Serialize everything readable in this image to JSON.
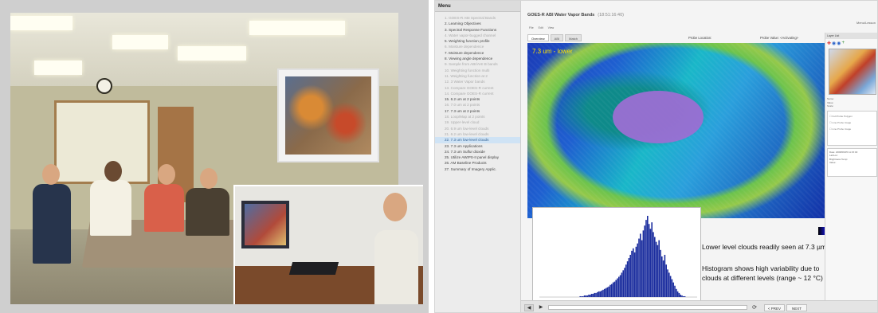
{
  "photo": {
    "alt_subject": "training room with participants and instructor workstation"
  },
  "app": {
    "menu_title": "Menu",
    "menu_items": [
      {
        "label": "1. GOES-R ABI Spectral Bands",
        "state": "dim"
      },
      {
        "label": "2. Learning Objectives",
        "state": "visited"
      },
      {
        "label": "3. Spectral Response Functions",
        "state": "visited"
      },
      {
        "label": "4. Water vapor-bugged channel",
        "state": "dim"
      },
      {
        "label": "5. Weighting function profile",
        "state": "visited"
      },
      {
        "label": "6. Moisture dependence",
        "state": "dim"
      },
      {
        "label": "7. Moisture dependence",
        "state": "visited"
      },
      {
        "label": "8. Viewing angle dependence",
        "state": "visited"
      },
      {
        "label": "9. Sample from ABI/AHI B bands",
        "state": "dim"
      },
      {
        "label": "10. Weighting function multi",
        "state": "dim"
      },
      {
        "label": "11. Weighting function at 2",
        "state": "dim"
      },
      {
        "label": "12. 3 Water Vapor bands",
        "state": "dim"
      },
      {
        "label": "13. Compare GOES-R current",
        "state": "dim"
      },
      {
        "label": "14. Compare GOES-R current",
        "state": "dim"
      },
      {
        "label": "15. 6.2 um at 2 points",
        "state": "visited"
      },
      {
        "label": "16. 7.0 um at 2 points",
        "state": "dim"
      },
      {
        "label": "17. 7.3 um at 2 points",
        "state": "visited"
      },
      {
        "label": "18. Loop/Map at 2 points",
        "state": "dim"
      },
      {
        "label": "19. Upper-level cloud",
        "state": "dim"
      },
      {
        "label": "20. 6.9 um low-level clouds",
        "state": "dim"
      },
      {
        "label": "21. 6.2 um low-level clouds",
        "state": "dim"
      },
      {
        "label": "22. 7.3 um low-level clouds",
        "state": "active"
      },
      {
        "label": "23. 7.3 um Applications",
        "state": "visited"
      },
      {
        "label": "24. 7.3 um Sulfur dioxide",
        "state": "visited"
      },
      {
        "label": "25. Utilize AWIPS-II panel display",
        "state": "visited"
      },
      {
        "label": "26. AM Baseline Products",
        "state": "visited"
      },
      {
        "label": "27. Summary of Imagery Applic.",
        "state": "visited"
      }
    ],
    "title": "GOES-R ABI Water Vapor Bands",
    "title_time": "(18:51:16:40)",
    "topright": "Menu/Lesson",
    "mini_tabs": [
      "File",
      "Edit",
      "View"
    ],
    "tabs": [
      {
        "label": "Overview",
        "active": true
      },
      {
        "label": "ABI",
        "active": false
      },
      {
        "label": "Match",
        "active": false
      }
    ],
    "probe_location_label": "Probe Location:",
    "probe_value_label": "Probe Value: <Activating>",
    "band_label": "7.3 um - lower",
    "annotation_1": "Lower level clouds readily seen at 7.3 µm.",
    "annotation_2": "Histogram shows high variability due to clouds at different levels (range ~ 12 °C)",
    "color_table": "Color table: 11 Alt random",
    "prev_label": "< PREV",
    "next_label": "NEXT",
    "refresh_glyph": "⟳",
    "play_glyph": "◀",
    "frame_glyph": "▶",
    "right_panel": {
      "header": "Layer List",
      "tools": [
        "✚",
        "◉",
        "◉",
        "+"
      ],
      "fields": [
        "Name:",
        "Value:",
        "Scale:"
      ],
      "checkbox_items": [
        "Full Probe Polygon",
        "Line Probe Image",
        "Line Probe Image"
      ],
      "info_lines": [
        "Date: 2008/06/05 11:15:00",
        "Lat/Lon:",
        "Brightness Temp:",
        "Value:"
      ]
    },
    "colors": {
      "active_menu_bg": "#cfe3f5",
      "band_label": "#ffe500",
      "probe_region": "#9b6fd3",
      "histogram_bars": "#1b2d9e"
    }
  },
  "chart_data": {
    "type": "bar",
    "title": "",
    "xlabel": "",
    "ylabel": "",
    "description_bins": "brightness temperature histogram of probe region, unimodal, right-skewed",
    "values": [
      0,
      0,
      0,
      0,
      0,
      0,
      0,
      0,
      0,
      0,
      0,
      0,
      0,
      0,
      0,
      0,
      0,
      0,
      0,
      0,
      0,
      0,
      0,
      0,
      0,
      0,
      0,
      0,
      1,
      1,
      1,
      2,
      2,
      2,
      3,
      3,
      4,
      4,
      5,
      5,
      6,
      7,
      7,
      8,
      9,
      10,
      11,
      12,
      13,
      15,
      16,
      18,
      19,
      21,
      23,
      25,
      27,
      30,
      33,
      36,
      40,
      44,
      48,
      52,
      57,
      60,
      55,
      62,
      66,
      72,
      78,
      70,
      82,
      88,
      95,
      100,
      90,
      84,
      92,
      80,
      74,
      68,
      64,
      70,
      58,
      50,
      45,
      52,
      40,
      34,
      30,
      26,
      22,
      18,
      14,
      10,
      7,
      5,
      3,
      2,
      1,
      1,
      0,
      0,
      0,
      0,
      0,
      0,
      0,
      0
    ]
  }
}
